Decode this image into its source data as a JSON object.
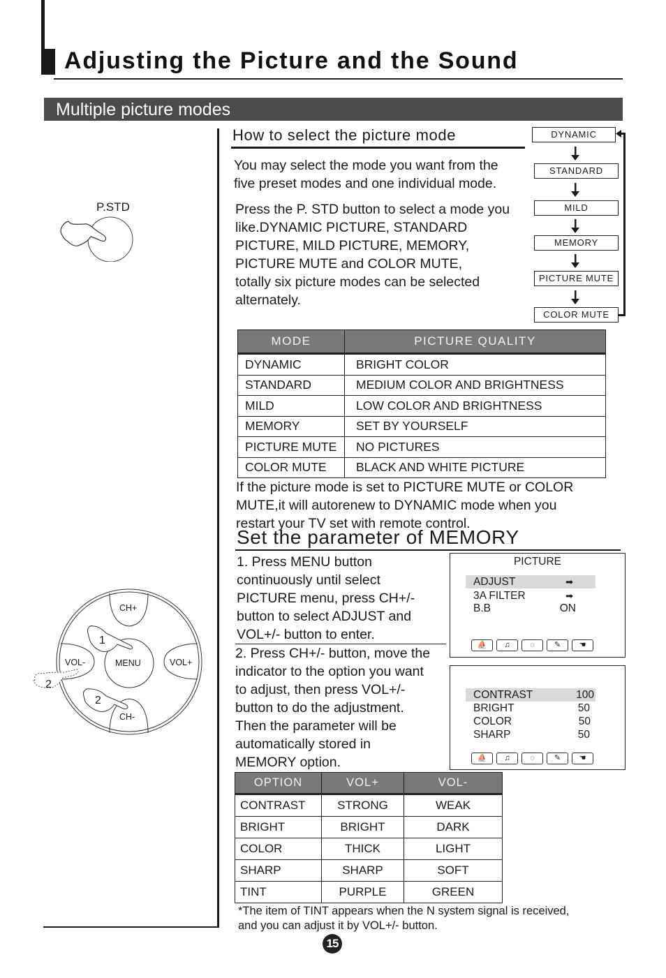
{
  "page": {
    "title": "Adjusting the Picture and the Sound",
    "section": "Multiple picture modes",
    "page_number": "15"
  },
  "select_mode": {
    "heading": "How to select the picture mode",
    "intro": [
      "You may select the mode you want  from the",
      "five preset modes and one individual mode."
    ],
    "instructions": [
      "Press the P. STD button to select a mode you",
      "like.DYNAMIC PICTURE, STANDARD",
      "PICTURE, MILD PICTURE, MEMORY,",
      "PICTURE MUTE and COLOR MUTE,",
      "totally six picture modes  can be selected",
      "alternately."
    ],
    "button_label": "P.STD",
    "mode_cycle": [
      "DYNAMIC",
      "STANDARD",
      "MILD",
      "MEMORY",
      "PICTURE MUTE",
      "COLOR MUTE"
    ]
  },
  "mode_table": {
    "headers": [
      "MODE",
      "PICTURE QUALITY"
    ],
    "rows": [
      [
        "DYNAMIC",
        "BRIGHT COLOR"
      ],
      [
        "STANDARD",
        "MEDIUM COLOR AND BRIGHTNESS"
      ],
      [
        "MILD",
        "LOW COLOR AND BRIGHTNESS"
      ],
      [
        "MEMORY",
        "SET BY YOURSELF"
      ],
      [
        "PICTURE MUTE",
        "NO PICTURES"
      ],
      [
        "COLOR MUTE",
        "BLACK AND WHITE PICTURE"
      ]
    ]
  },
  "mute_note": [
    "If the picture mode is set to PICTURE MUTE or COLOR",
    "MUTE,it will autorenew to DYNAMIC mode when you",
    "restart your TV set with remote control."
  ],
  "memory": {
    "heading": "Set the parameter of MEMORY",
    "step1": [
      "1. Press MENU button",
      "continuously until select",
      "PICTURE menu, press CH+/-",
      "button to select ADJUST and",
      "VOL+/- button to enter."
    ],
    "step2": [
      "2. Press CH+/- button, move the",
      "indicator  to the option you want",
      "to adjust, then press VOL+/-",
      "button to do the adjustment.",
      "Then the parameter  will be",
      "automatically stored in",
      "MEMORY option."
    ]
  },
  "remote": {
    "buttons": {
      "ch_up": "CH+",
      "ch_down": "CH-",
      "vol_down": "VOL-",
      "vol_up": "VOL+",
      "menu": "MENU"
    },
    "step_markers": [
      "1",
      "2",
      "2"
    ]
  },
  "osd_picture_menu": {
    "title": "PICTURE",
    "items": [
      {
        "label": "ADJUST",
        "value": "➡",
        "highlighted": true
      },
      {
        "label": "3A FILTER",
        "value": "➡",
        "highlighted": false
      },
      {
        "label": "B.B",
        "value": "ON",
        "highlighted": false
      }
    ],
    "icons": [
      "picture-icon",
      "sound-icon",
      "timer-icon",
      "setup-icon",
      "function-icon"
    ]
  },
  "osd_adjust_menu": {
    "items": [
      {
        "label": "CONTRAST",
        "value": "100",
        "highlighted": true
      },
      {
        "label": "BRIGHT",
        "value": "50",
        "highlighted": false
      },
      {
        "label": "COLOR",
        "value": "50",
        "highlighted": false
      },
      {
        "label": "SHARP",
        "value": "50",
        "highlighted": false
      }
    ]
  },
  "option_table": {
    "headers": [
      "OPTION",
      "VOL+",
      "VOL-"
    ],
    "rows": [
      [
        "CONTRAST",
        "STRONG",
        "WEAK"
      ],
      [
        "BRIGHT",
        "BRIGHT",
        "DARK"
      ],
      [
        "COLOR",
        "THICK",
        "LIGHT"
      ],
      [
        "SHARP",
        "SHARP",
        "SOFT"
      ],
      [
        "TINT",
        "PURPLE",
        "GREEN"
      ]
    ]
  },
  "footnote": [
    "*The item of TINT appears when the N system signal is received,",
    "and you can adjust it by VOL+/- button."
  ]
}
